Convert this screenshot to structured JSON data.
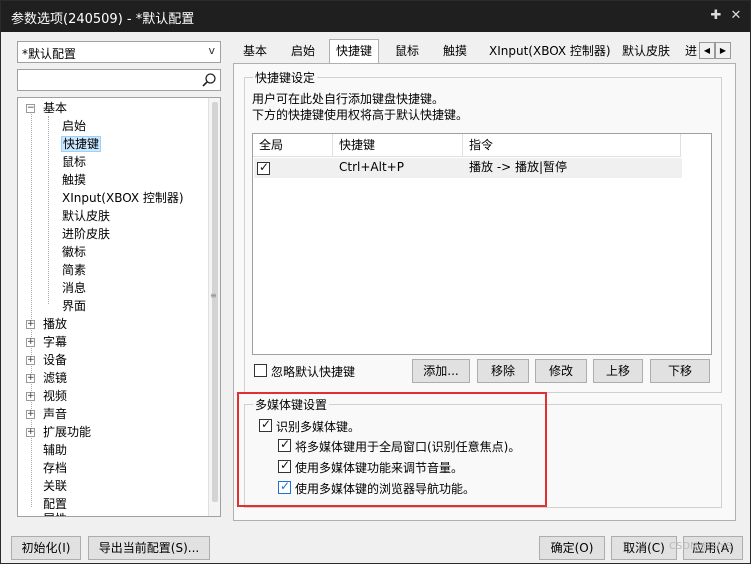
{
  "window": {
    "title": "参数选项(240509) - *默认配置"
  },
  "sidebar": {
    "preset": "*默认配置",
    "search_placeholder": "",
    "tree": [
      {
        "label": "基本",
        "expander": "−"
      },
      {
        "label": "启始"
      },
      {
        "label": "快捷键"
      },
      {
        "label": "鼠标"
      },
      {
        "label": "触摸"
      },
      {
        "label": "XInput(XBOX 控制器)"
      },
      {
        "label": "默认皮肤"
      },
      {
        "label": "进阶皮肤"
      },
      {
        "label": "徽标"
      },
      {
        "label": "简素"
      },
      {
        "label": "消息"
      },
      {
        "label": "界面"
      },
      {
        "label": "播放",
        "expander": "+"
      },
      {
        "label": "字幕",
        "expander": "+"
      },
      {
        "label": "设备",
        "expander": "+"
      },
      {
        "label": "滤镜",
        "expander": "+"
      },
      {
        "label": "视频",
        "expander": "+"
      },
      {
        "label": "声音",
        "expander": "+"
      },
      {
        "label": "扩展功能",
        "expander": "+"
      },
      {
        "label": "辅助"
      },
      {
        "label": "存档"
      },
      {
        "label": "关联"
      },
      {
        "label": "配置"
      },
      {
        "label": "属性"
      }
    ]
  },
  "tabs": [
    "基本",
    "启始",
    "快捷键",
    "鼠标",
    "触摸",
    "XInput(XBOX 控制器)",
    "默认皮肤",
    "进"
  ],
  "hotkeys": {
    "group_title": "快捷键设定",
    "desc1": "用户可在此处自行添加键盘快捷键。",
    "desc2": "下方的快捷键使用权将高于默认快捷键。",
    "columns": [
      "全局",
      "快捷键",
      "指令"
    ],
    "rows": [
      {
        "global": "✓",
        "key": "Ctrl+Alt+P",
        "command": "播放 -> 播放|暂停"
      }
    ],
    "ignore_default_label": "忽略默认快捷键",
    "buttons": {
      "add": "添加...",
      "remove": "移除",
      "modify": "修改",
      "up": "上移",
      "down": "下移"
    }
  },
  "media": {
    "group_title": "多媒体键设置",
    "recognize": "识别多媒体键。",
    "global_window": "将多媒体键用于全局窗口(识别任意焦点)。",
    "volume": "使用多媒体键功能来调节音量。",
    "browser_nav": "使用多媒体键的浏览器导航功能。"
  },
  "footer": {
    "init": "初始化(I)",
    "export": "导出当前配置(S)...",
    "ok": "确定(O)",
    "cancel": "取消(C)",
    "apply": "应用(A)"
  },
  "watermark": "CSDN @ShiS",
  "colors": {
    "highlight": "#e03131",
    "selection": "#cce8ff",
    "titlebar": "#1f1f1f"
  }
}
